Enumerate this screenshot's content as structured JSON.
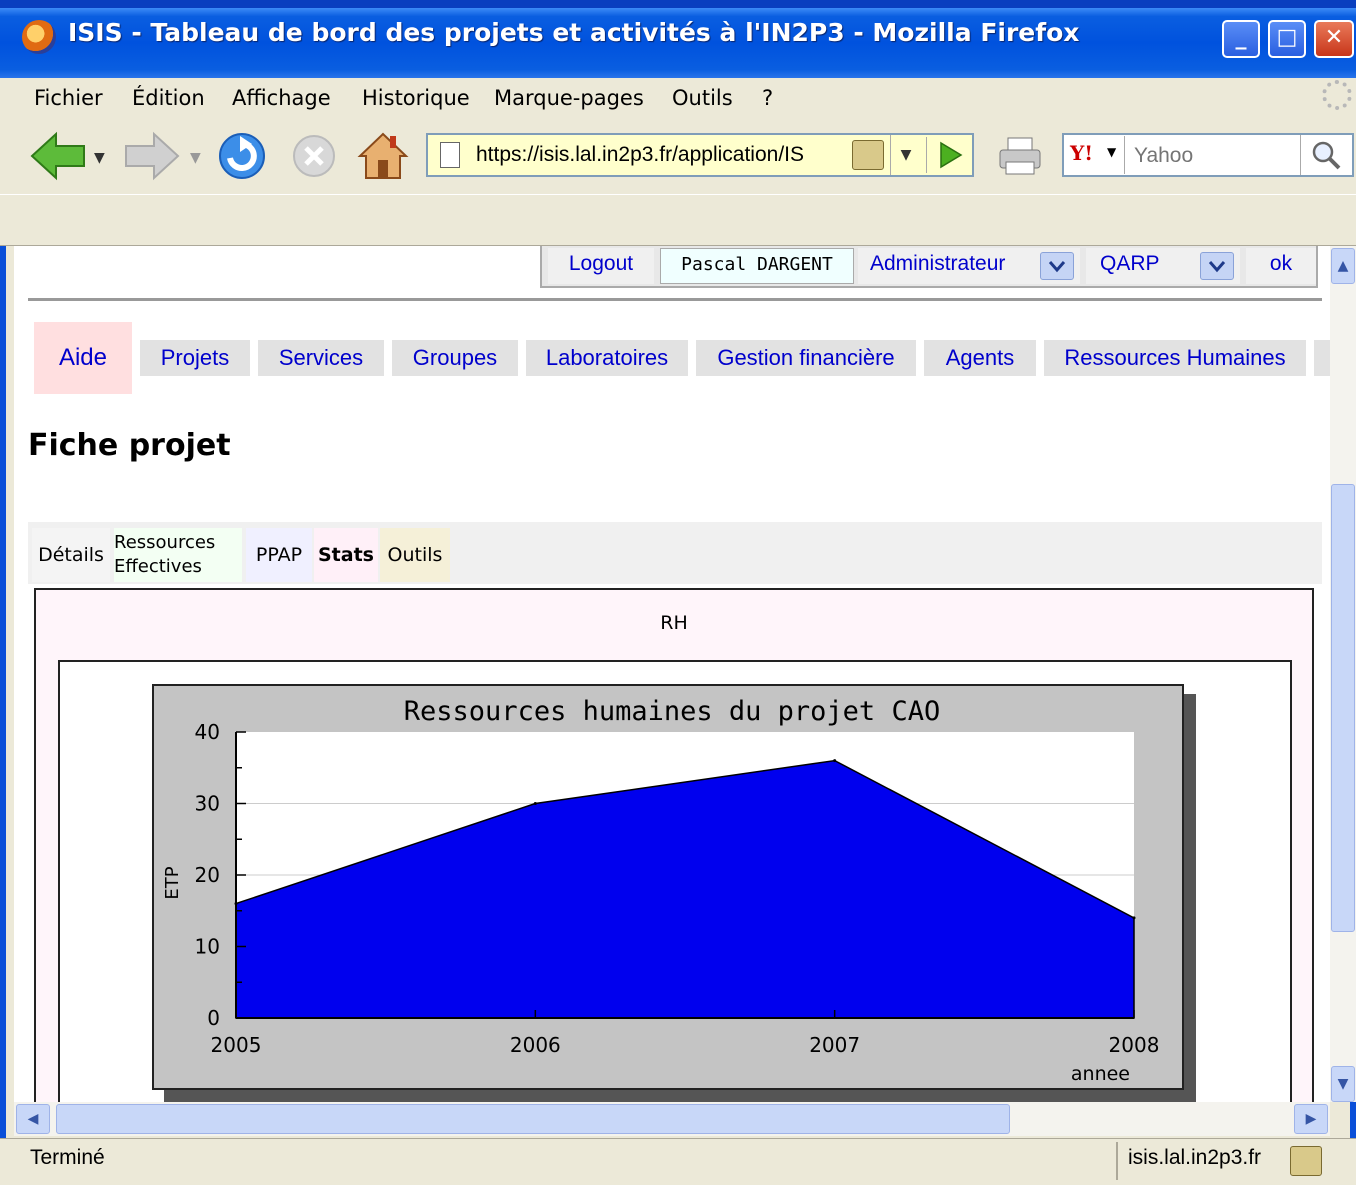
{
  "window": {
    "title": "ISIS - Tableau de bord des projets et activités à l'IN2P3 - Mozilla Firefox",
    "min": "_",
    "max": "□",
    "close": "✕"
  },
  "menu": [
    "Fichier",
    "Édition",
    "Affichage",
    "Historique",
    "Marque-pages",
    "Outils",
    "?"
  ],
  "toolbar": {
    "url": "https://isis.lal.in2p3.fr/application/IS",
    "search_placeholder": "Yahoo",
    "search_engine": "Y!"
  },
  "userbar": {
    "logout": "Logout",
    "user": "Pascal DARGENT",
    "role": "Administrateur",
    "project": "QARP",
    "ok": "ok"
  },
  "nav": {
    "aide": "Aide",
    "tabs": [
      "Projets",
      "Services",
      "Groupes",
      "Laboratoires",
      "Gestion financière",
      "Agents",
      "Ressources Humaines"
    ]
  },
  "page_title": "Fiche projet",
  "subtabs": {
    "details": "Détails",
    "ressources_1": "Ressources",
    "ressources_2": "Effectives",
    "ppap": "PPAP",
    "stats": "Stats",
    "outils": "Outils"
  },
  "panel_heading": "RH",
  "chart_data": {
    "type": "area",
    "title": "Ressources humaines du projet CAO",
    "xlabel": "annee",
    "ylabel": "ETP",
    "x": [
      2005,
      2006,
      2007,
      2008
    ],
    "values": [
      16,
      30,
      36,
      14
    ],
    "ylim": [
      0,
      40
    ],
    "yticks": [
      "0",
      "10",
      "20",
      "30",
      "40"
    ],
    "xticks": [
      "2005",
      "2006",
      "2007",
      "2008"
    ],
    "fill_color": "#0000EE",
    "background_color": "#C4C4C4",
    "grid": true
  },
  "status": {
    "text": "Terminé",
    "host": "isis.lal.in2p3.fr"
  }
}
